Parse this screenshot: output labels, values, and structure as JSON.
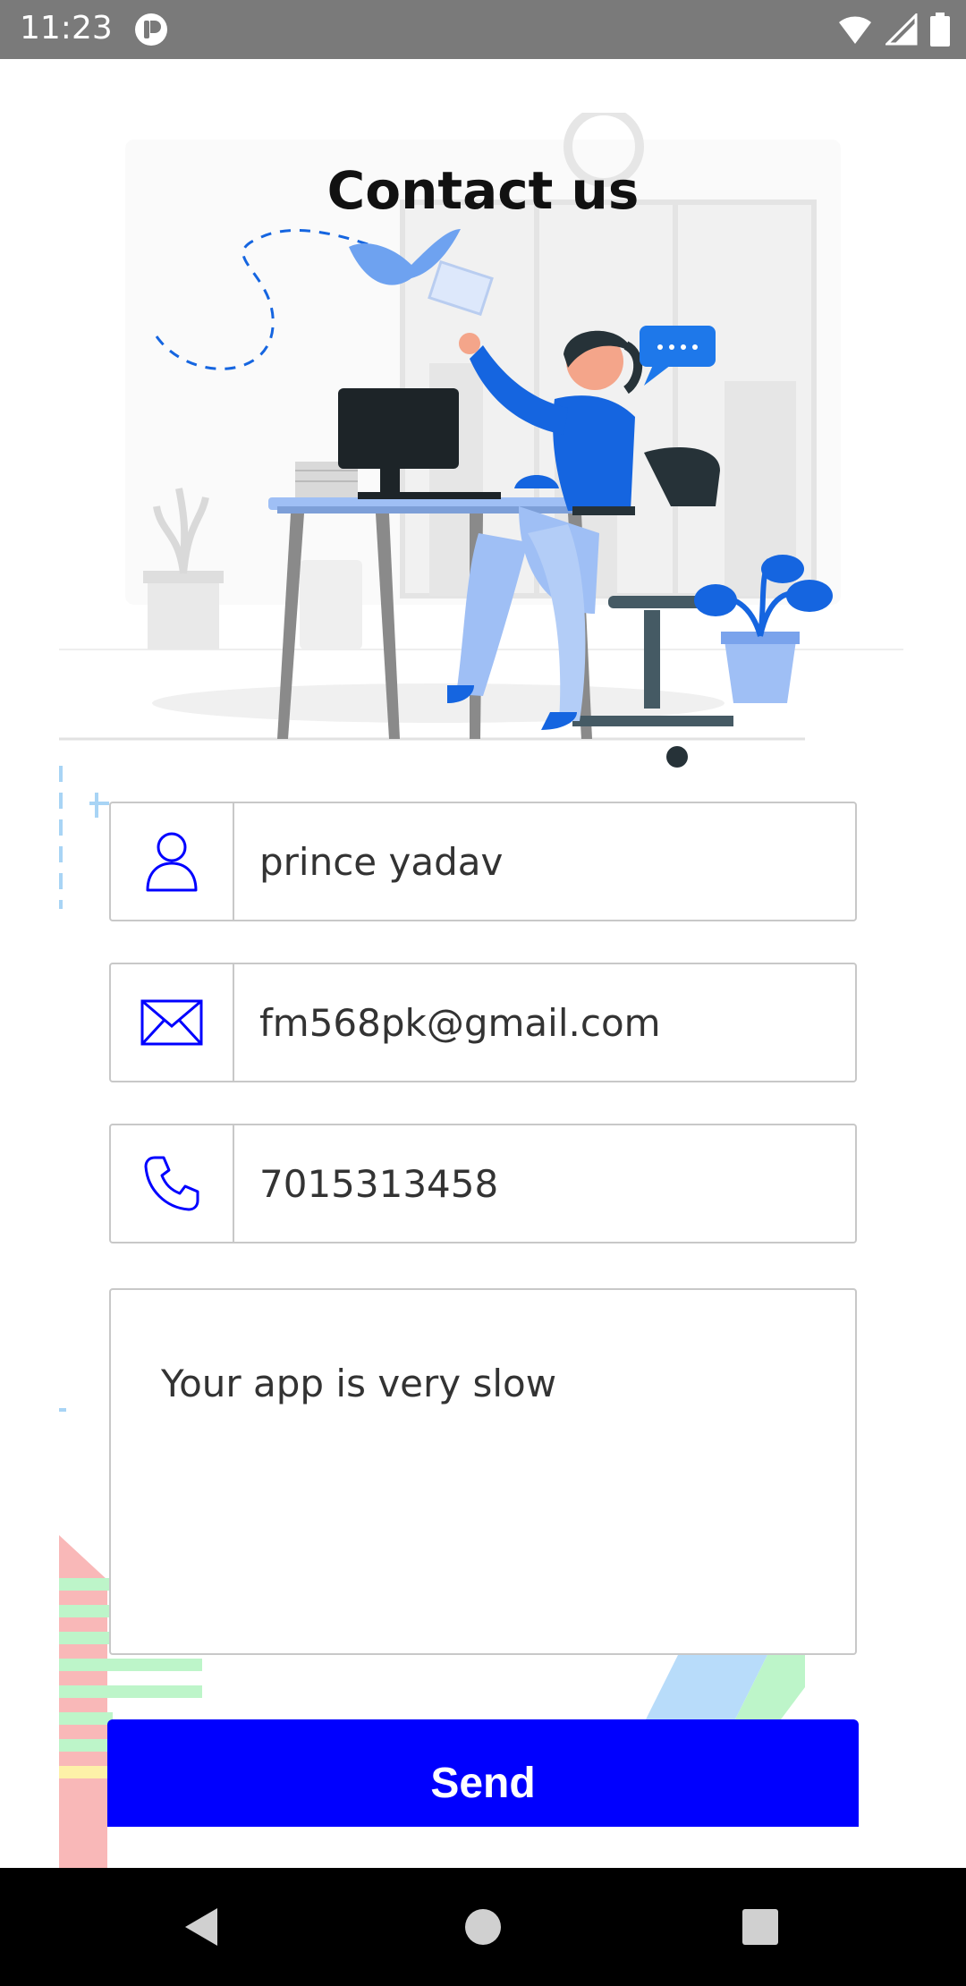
{
  "status_bar": {
    "time": "11:23",
    "icons": [
      "app-notification-icon",
      "wifi-icon",
      "signal-icon",
      "battery-icon"
    ]
  },
  "page": {
    "title": "Contact us"
  },
  "form": {
    "name": {
      "icon": "person-icon",
      "value": "prince yadav"
    },
    "email": {
      "icon": "mail-icon",
      "value": "fm568pk@gmail.com"
    },
    "phone": {
      "icon": "phone-icon",
      "value": "7015313458"
    },
    "message": {
      "value": "Your app is very slow"
    },
    "send_label": "Send"
  },
  "nav_bar": {
    "buttons": [
      "back",
      "home",
      "recents"
    ]
  },
  "colors": {
    "accent": "#0000ff",
    "illustration_blue": "#1565e0",
    "status_bar": "#7a7a7a"
  }
}
